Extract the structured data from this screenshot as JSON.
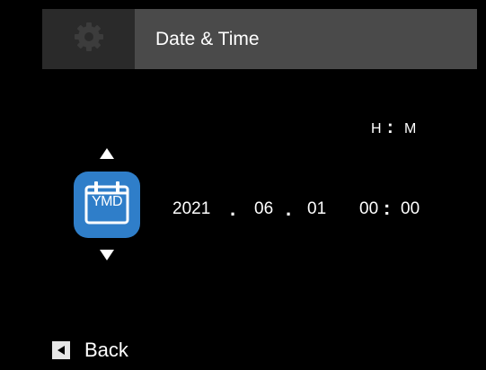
{
  "header": {
    "icon": "gear-icon",
    "title": "Date & Time"
  },
  "time_format": {
    "hour_label": "H",
    "separator": ":",
    "minute_label": "M"
  },
  "format_selector": {
    "label": "YMD",
    "icon": "calendar-icon",
    "up_icon": "triangle-up-icon",
    "down_icon": "triangle-down-icon"
  },
  "date": {
    "year": "2021",
    "month": "06",
    "day": "01",
    "separator": "."
  },
  "time": {
    "hour": "00",
    "minute": "00",
    "separator": ":"
  },
  "footer": {
    "back_icon": "triangle-left-icon",
    "back_label": "Back"
  },
  "colors": {
    "background": "#000000",
    "header_bar": "#4a4a4a",
    "header_tab": "#2a2a2a",
    "accent": "#2f7ec9",
    "text": "#ffffff"
  }
}
